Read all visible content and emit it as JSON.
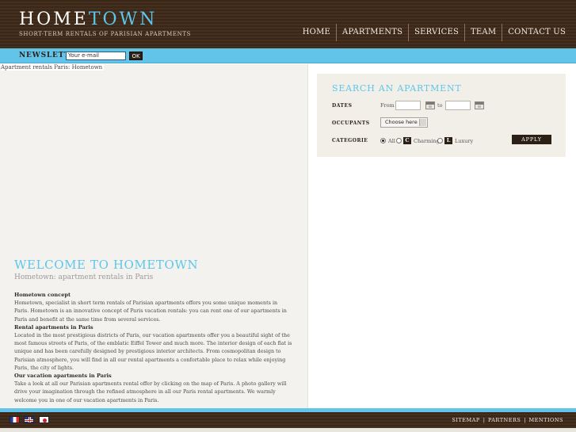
{
  "brand": {
    "title_home": "Home",
    "title_town": "Town",
    "tagline": "Short-Term Rentals of Parisian Apartments"
  },
  "nav": [
    "Home",
    "Apartments",
    "Services",
    "Team",
    "Contact us"
  ],
  "newsletter": {
    "label": "Newsletter",
    "email_value": "Your e-mail",
    "ok_label": "OK"
  },
  "breadcrumb": "Apartment rentals Paris: Hometown",
  "welcome": {
    "title": "Welcome to HomeTown",
    "subtitle": "Hometown: apartment rentals in Paris"
  },
  "sections": [
    {
      "heading": "Hometown concept",
      "text": "Hometown, specialist in short term rentals of Parisian apartments offers you some unique moments in Paris. Hometown is an innovative concept of Paris vacation rentals: you can rent one of our apartments in Paris and benefit at the same time from several services."
    },
    {
      "heading": "Rental apartments in Paris",
      "text": "Located in the most prestigious districts of Paris, our vacation apartments offer you a beautiful sight of the most famous streets of Paris, of the emblatic Eiffel Tower and much more. The interior design of each flat is unique and has been carefully designed by prestigious interior architects. From cosmopolitan design to Parisian atmosphere, you will find in all our rental apartments a confortable place to relax while enjoying Paris, the city of lights."
    },
    {
      "heading": "Our vacation apartments in Paris",
      "text": "Take a look at all our Parisian apartments rental offer by clicking on the map of Paris. A photo gallery will drive your imagination through the refined atmosphere in all our Paris rental apartments. We warmly welcome you in one of our vacation apartments in Paris."
    }
  ],
  "search": {
    "title": "Search an apartment",
    "dates_label": "Dates",
    "from_label": "From",
    "to_label": "to",
    "occupants_label": "Occupants",
    "occupants_value": "Choose here",
    "categorie_label": "Categorie",
    "cat_all": "All",
    "cat_charming": "Charming",
    "cat_luxury": "Luxury",
    "badge_c": "C",
    "badge_l": "L",
    "apply_label": "Apply"
  },
  "footer": {
    "links": [
      "Sitemap",
      "Partners",
      "Mentions"
    ],
    "separator": "|",
    "languages": [
      "flag-fr-icon",
      "flag-uk-icon",
      "flag-jp-icon"
    ]
  },
  "colors": {
    "header_brown": "#3a2718",
    "accent_blue": "#63c4ea",
    "title_blue": "#5cc6ec",
    "panel_beige": "#f2efe9"
  }
}
